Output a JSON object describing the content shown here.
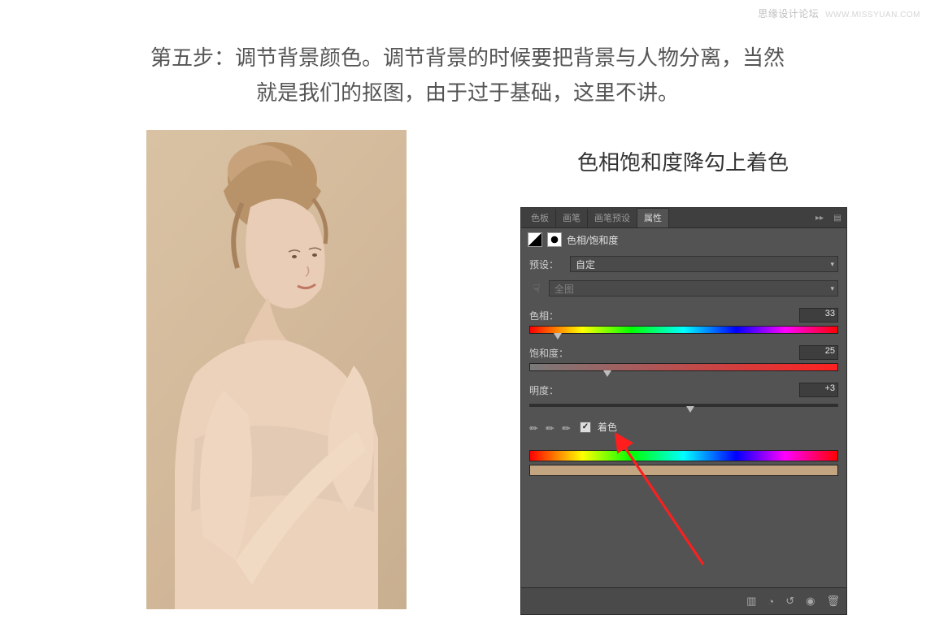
{
  "watermark": {
    "title": "思缘设计论坛",
    "url": "WWW.MISSYUAN.COM"
  },
  "header": {
    "step_label": "第五步：",
    "line1": "调节背景颜色。调节背景的时候要把背景与人物分离，当然",
    "line2": "就是我们的抠图，由于过于基础，这里不讲。"
  },
  "panel_caption": "色相饱和度降勾上着色",
  "tabs": {
    "swatches": "色板",
    "brushes": "画笔",
    "brush_presets": "画笔预设",
    "properties": "属性"
  },
  "panel_title": "色相/饱和度",
  "rows": {
    "preset_label": "预设：",
    "preset_value": "自定",
    "scope_value": "全图",
    "hue_label": "色相：",
    "hue_value": "33",
    "sat_label": "饱和度：",
    "sat_value": "25",
    "light_label": "明度：",
    "light_value": "+3",
    "colorize_label": "着色"
  }
}
